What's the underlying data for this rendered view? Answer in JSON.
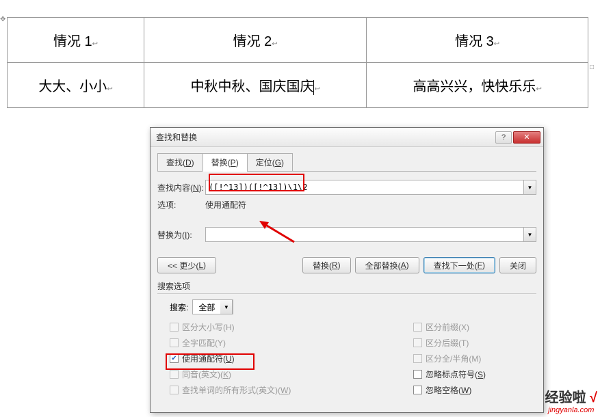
{
  "table": {
    "r1c1": "情况 1",
    "r1c2": "情况 2",
    "r1c3": "情况 3",
    "r2c1": "大大、小小",
    "r2c2": "中秋中秋、国庆国庆",
    "r2c3": "高高兴兴，快快乐乐"
  },
  "dialog": {
    "title": "查找和替换",
    "help_icon": "?",
    "close_icon": "✕",
    "tabs": {
      "find": "查找(D)",
      "replace": "替换(P)",
      "goto": "定位(G)"
    },
    "find_label": "查找内容(N):",
    "find_value": "([!^13])([!^13])\\1\\2",
    "options_label": "选项:",
    "options_value": "使用通配符",
    "replace_label": "替换为(I):",
    "replace_value": "",
    "buttons": {
      "less": "<< 更少(L)",
      "replace": "替换(R)",
      "replace_all": "全部替换(A)",
      "find_next": "查找下一处(F)",
      "close": "关闭"
    },
    "search_options_label": "搜索选项",
    "search_label": "搜索:",
    "search_value": "全部",
    "checks_left": {
      "case": "区分大小写(H)",
      "whole": "全字匹配(Y)",
      "wildcard": "使用通配符(U)",
      "sounds": "同音(英文)(K)",
      "forms": "查找单词的所有形式(英文)(W)"
    },
    "checks_right": {
      "prefix": "区分前缀(X)",
      "suffix": "区分后缀(T)",
      "width": "区分全/半角(M)",
      "punct": "忽略标点符号(S)",
      "space": "忽略空格(W)"
    }
  },
  "watermark": {
    "top": "经验啦",
    "check": "√",
    "bottom": "jingyanla.com"
  }
}
